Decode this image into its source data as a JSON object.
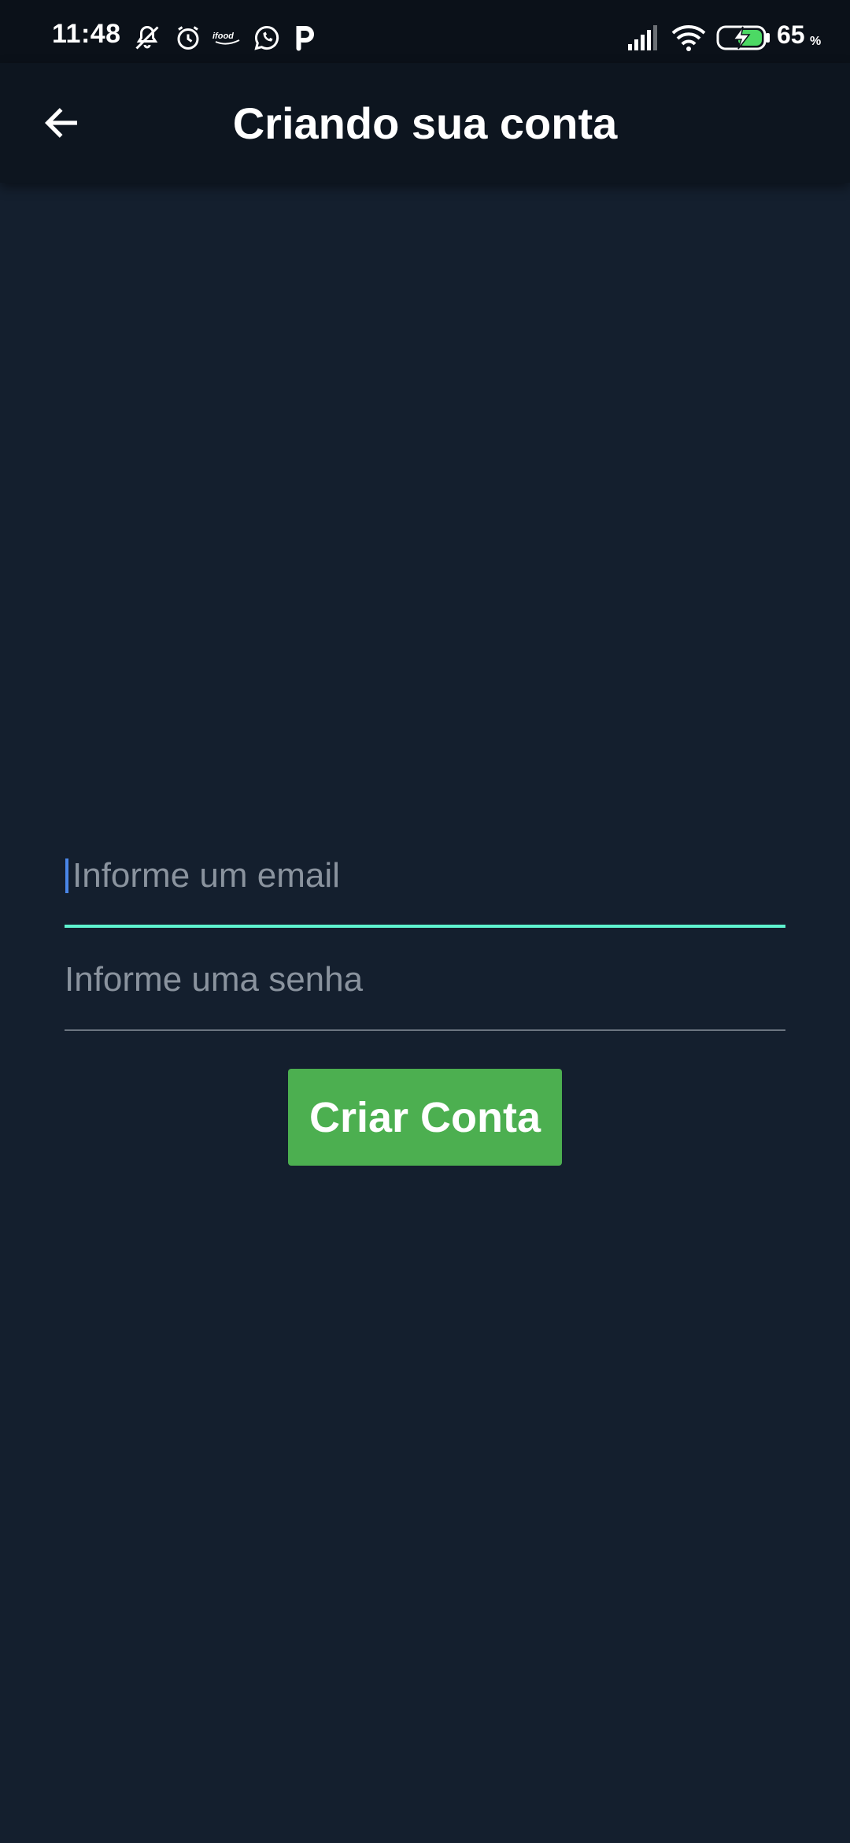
{
  "status_bar": {
    "time": "11:48",
    "battery_level": "65",
    "battery_unit": "%",
    "icons": [
      "notifications-muted-icon",
      "alarm-icon",
      "ifood-icon",
      "whatsapp-icon",
      "parking-icon",
      "signal-icon",
      "wifi-icon",
      "battery-charging-icon"
    ]
  },
  "app_bar": {
    "title": "Criando sua conta",
    "back_icon": "arrow-left-icon"
  },
  "form": {
    "email": {
      "value": "",
      "placeholder": "Informe um email",
      "focused": true
    },
    "password": {
      "value": "",
      "placeholder": "Informe uma senha"
    },
    "submit_label": "Criar Conta"
  },
  "colors": {
    "background": "#141f2e",
    "app_bar": "#0d151f",
    "focus_accent": "#5ef2cf",
    "button": "#4caf50",
    "caret": "#4a86e8"
  }
}
